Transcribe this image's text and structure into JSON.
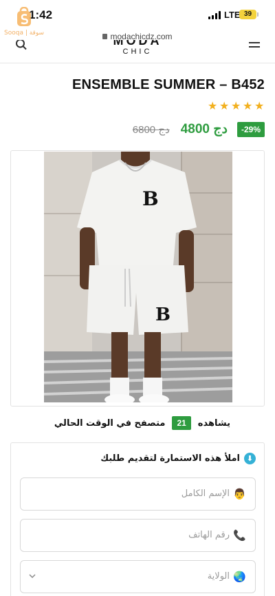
{
  "status_bar": {
    "time": "1:42",
    "network": "LTE",
    "battery": "39"
  },
  "watermark": {
    "text": "Sooqa | سوقة"
  },
  "browser": {
    "url": "modachicdz.com"
  },
  "site": {
    "brand_top": "MODA",
    "brand_sub": "CHIC"
  },
  "product": {
    "title": "ENSEMBLE SUMMER – B452",
    "rating": 5,
    "old_price": "6800 دج",
    "new_price": "4800 دج",
    "discount": "-29%",
    "image_alt": "white t-shirt and shorts set"
  },
  "viewers": {
    "prefix": "يشاهده",
    "count": "21",
    "suffix": "متصفح في الوقت الحالي"
  },
  "form": {
    "heading": "املأ هذه الاستمارة لتقديم طلبك",
    "fields": [
      {
        "icon": "person-icon",
        "icon_char": "👨",
        "placeholder": "الإسم الكامل"
      },
      {
        "icon": "phone-icon",
        "icon_char": "📞",
        "placeholder": "رقم الهاتف"
      },
      {
        "icon": "globe-icon",
        "icon_char": "🌏",
        "placeholder": "الولاية"
      }
    ]
  },
  "colors": {
    "accent_green": "#2e9c3f",
    "star_yellow": "#f2b01e",
    "battery": "#f3d23d",
    "info_blue": "#35b1d6"
  }
}
